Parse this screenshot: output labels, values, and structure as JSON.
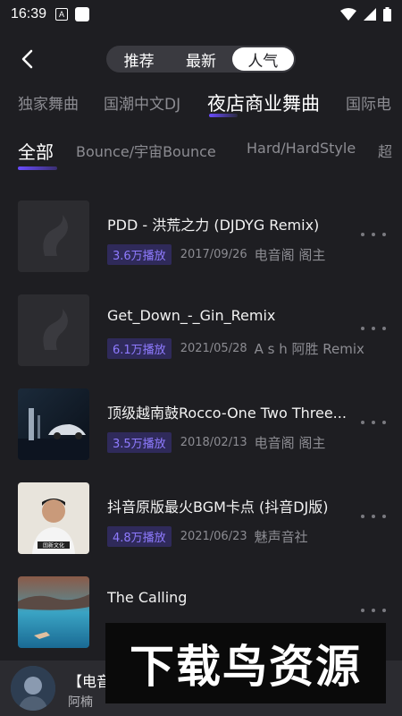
{
  "status_bar": {
    "time": "16:39",
    "notif_letter": "A"
  },
  "header": {
    "tabs": [
      {
        "label": "推荐"
      },
      {
        "label": "最新"
      },
      {
        "label": "人气"
      }
    ]
  },
  "categories": [
    "独家舞曲",
    "国潮中文DJ",
    "夜店商业舞曲",
    "国际电"
  ],
  "subcategories": [
    "全部",
    "Bounce/宇宙Bounce",
    "Hard/HardStyle",
    "超"
  ],
  "songs": [
    {
      "title": "PDD - 洪荒之力 (DJDYG Remix)",
      "plays": "3.6万播放",
      "date": "2017/09/26",
      "author": "电音阁 阁主"
    },
    {
      "title": "Get_Down_-_Gin_Remix",
      "plays": "6.1万播放",
      "date": "2021/05/28",
      "author": "A s h 阿胜 Remix"
    },
    {
      "title": "顶级越南鼓Rocco-One Two Three...",
      "plays": "3.5万播放",
      "date": "2018/02/13",
      "author": "电音阁 阁主"
    },
    {
      "title": "抖音原版最火BGM卡点 (抖音DJ版)",
      "plays": "4.8万播放",
      "date": "2021/06/23",
      "author": "魅声音社"
    },
    {
      "title": "The Calling",
      "plays": "",
      "date": "",
      "author": ""
    }
  ],
  "cover_text": {
    "song4_badge": "国新文化"
  },
  "player": {
    "title": "【电音",
    "subtitle": "阿楠"
  },
  "watermark": {
    "text": "下载鸟资源"
  },
  "colors": {
    "accent": "#6a4cff",
    "background": "#1e1e22",
    "plays_badge_bg": "#2f2a5a",
    "plays_badge_fg": "#8f7bff"
  }
}
